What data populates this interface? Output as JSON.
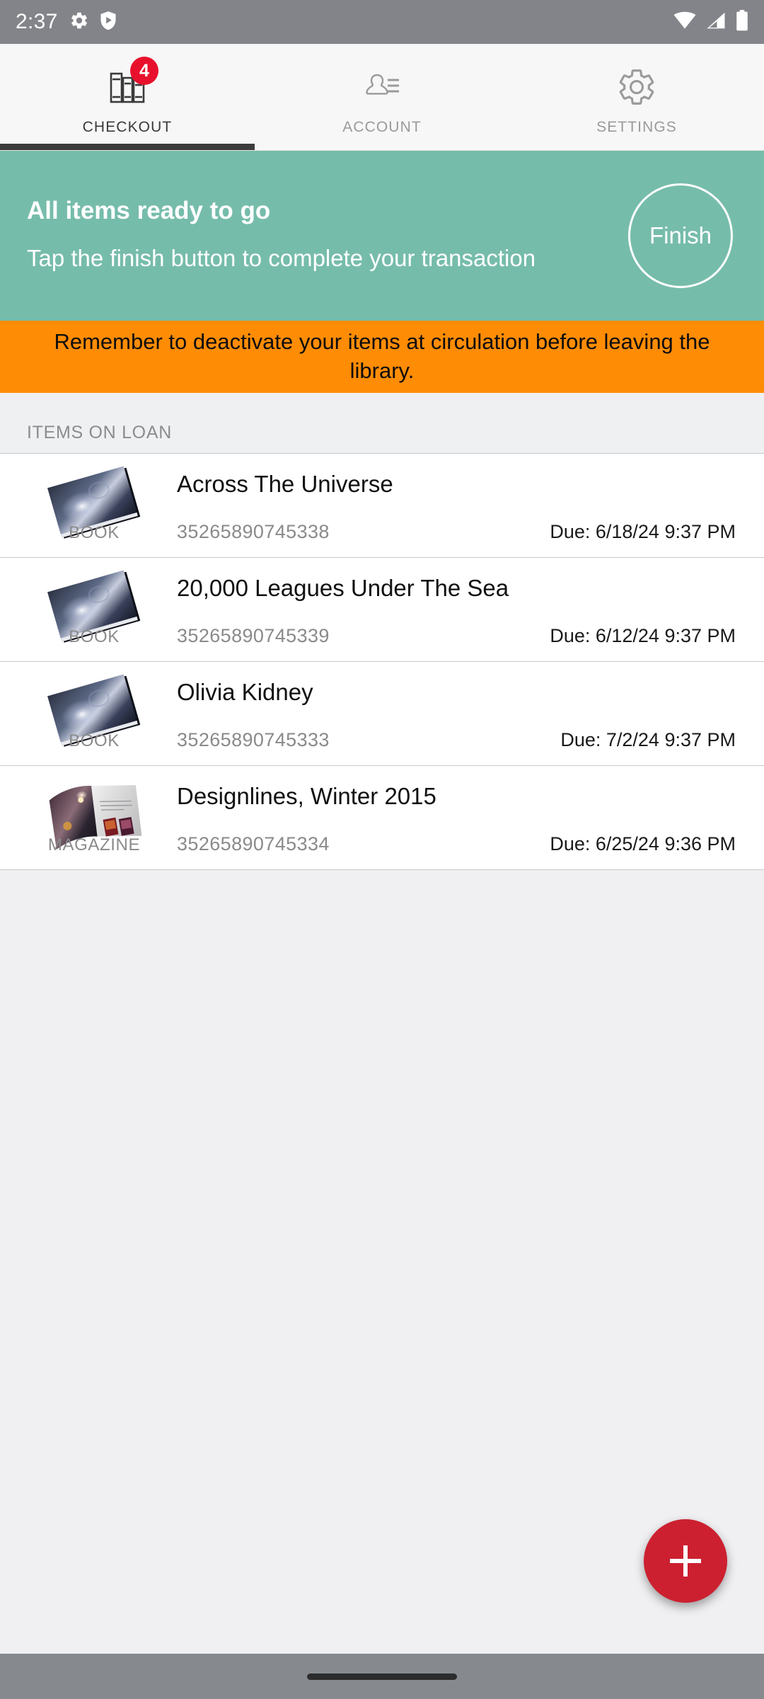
{
  "status_bar": {
    "time": "2:37",
    "left_icons": [
      "gear-icon",
      "play-shield-icon"
    ],
    "right_icons": [
      "wifi-icon",
      "signal-icon",
      "battery-icon"
    ],
    "background_color": "#828489"
  },
  "tabs": [
    {
      "label": "CHECKOUT",
      "icon": "books-icon",
      "active": true,
      "badge": "4"
    },
    {
      "label": "ACCOUNT",
      "icon": "person-list-icon",
      "active": false,
      "badge": ""
    },
    {
      "label": "SETTINGS",
      "icon": "gear-icon",
      "active": false,
      "badge": ""
    }
  ],
  "hero": {
    "title": "All items ready to go",
    "subtitle": "Tap the finish button to complete your transaction",
    "finish_label": "Finish",
    "background_color": "#76BCAB"
  },
  "warning": {
    "text": "Remember to deactivate your items at circulation before leaving the library.",
    "background_color": "#FF8C05"
  },
  "section": {
    "header": "ITEMS ON LOAN"
  },
  "items": [
    {
      "title": "Across The Universe",
      "type": "BOOK",
      "barcode": "35265890745338",
      "due": "Due: 6/18/24 9:37 PM",
      "thumb": "book-cover-icon"
    },
    {
      "title": "20,000 Leagues Under The Sea",
      "type": "BOOK",
      "barcode": "35265890745339",
      "due": "Due: 6/12/24 9:37 PM",
      "thumb": "book-cover-icon"
    },
    {
      "title": "Olivia Kidney",
      "type": "BOOK",
      "barcode": "35265890745333",
      "due": "Due: 7/2/24 9:37 PM",
      "thumb": "book-cover-icon"
    },
    {
      "title": "Designlines, Winter 2015",
      "type": "MAGAZINE",
      "barcode": "35265890745334",
      "due": "Due: 6/25/24 9:36 PM",
      "thumb": "magazine-cover-icon"
    }
  ],
  "fab": {
    "icon": "plus-icon",
    "background_color": "#CC2030"
  },
  "nav_bar": {
    "icon": "home-pill-icon",
    "background_color": "#868A8E"
  }
}
